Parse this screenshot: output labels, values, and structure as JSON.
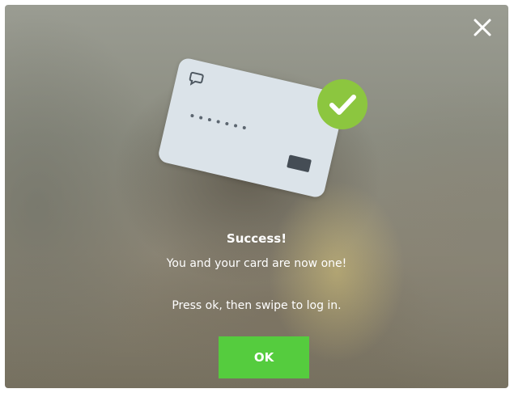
{
  "dialog": {
    "title": "Success!",
    "message": "You and your card are now one!",
    "instruction": "Press ok, then swipe to log in.",
    "ok_label": "OK"
  },
  "icons": {
    "close": "close-icon",
    "card": "credit-card-icon",
    "check": "checkmark-icon",
    "card_logo": "speech-bubble-logo-icon"
  },
  "colors": {
    "ok_button": "#55cc3e",
    "check_badge": "#8cc63f",
    "card": "#dbe3e9",
    "text": "#ffffff"
  }
}
